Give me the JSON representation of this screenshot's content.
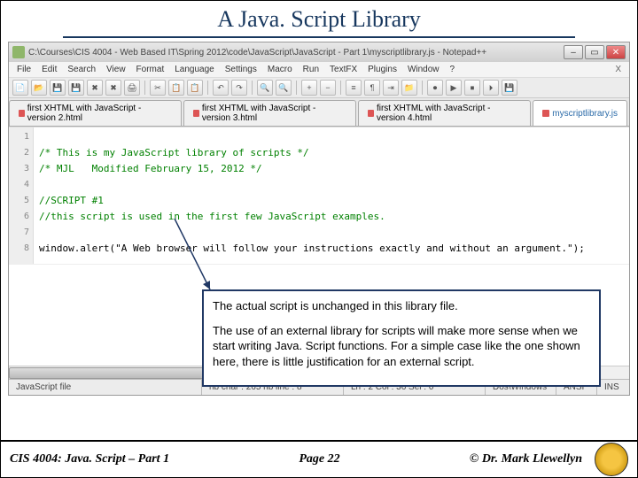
{
  "slide": {
    "title": "A Java. Script Library"
  },
  "window": {
    "title": "C:\\Courses\\CIS 4004 - Web Based IT\\Spring 2012\\code\\JavaScript\\JavaScript - Part 1\\myscriptlibrary.js - Notepad++"
  },
  "menus": [
    "File",
    "Edit",
    "Search",
    "View",
    "Format",
    "Language",
    "Settings",
    "Macro",
    "Run",
    "TextFX",
    "Plugins",
    "Window",
    "?"
  ],
  "menu_ext": "X",
  "tabs": [
    {
      "label": "first XHTML with JavaScript - version 2.html",
      "active": false
    },
    {
      "label": "first XHTML with JavaScript - version 3.html",
      "active": false
    },
    {
      "label": "first XHTML with JavaScript - version 4.html",
      "active": false
    },
    {
      "label": "myscriptlibrary.js",
      "active": true
    }
  ],
  "gutter": [
    "1",
    "2",
    "3",
    "4",
    "5",
    "6",
    "7",
    "8"
  ],
  "code": {
    "l1": "/* This is my JavaScript library of scripts */",
    "l2": "/* MJL   Modified February 15, 2012 */",
    "l3": "",
    "l4": "//SCRIPT #1",
    "l5": "//this script is used in the first few JavaScript examples.",
    "l6": "",
    "l7": "window.alert(\"A Web browser will follow your instructions exactly and without an argument.\");",
    "l8": ""
  },
  "status": {
    "filetype": "JavaScript file",
    "chars": "nb char : 265   nb line : 8",
    "pos": "Ln : 2   Col : 36   Sel : 0",
    "eol": "Dos\\Windows",
    "enc": "ANSI",
    "ins": "INS"
  },
  "callout": {
    "p1": "The actual script is unchanged in this library file.",
    "p2": "The use of an external library for scripts will make more sense when we start writing Java. Script functions.  For a simple case like the one shown here, there is little justification for an external script."
  },
  "footer": {
    "left": "CIS 4004: Java. Script – Part 1",
    "mid": "Page 22",
    "right": "© Dr. Mark Llewellyn"
  }
}
